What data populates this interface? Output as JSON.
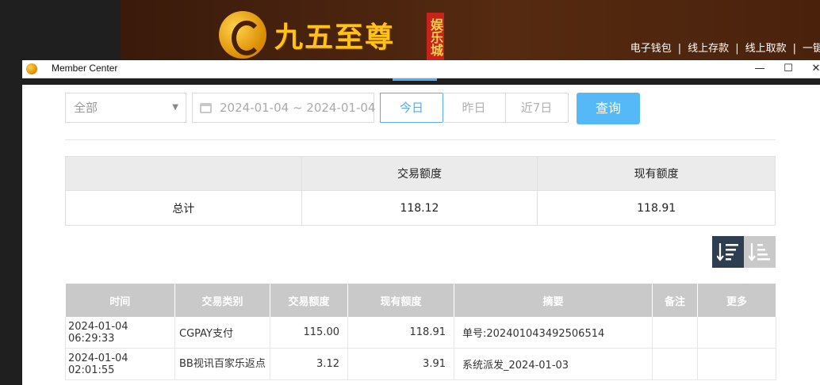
{
  "site": {
    "logo_text": "九五至尊",
    "logo_badge": "娱乐城",
    "links": [
      "电子钱包",
      "线上存款",
      "线上取款",
      "一键"
    ]
  },
  "window": {
    "title": "Member Center",
    "minimize": "—",
    "maximize": "☐",
    "close": "✕"
  },
  "filters": {
    "type_select": "全部",
    "date_range": "2024-01-04 ~ 2024-01-04",
    "quick": [
      "今日",
      "昨日",
      "近7日"
    ],
    "active_quick": "今日",
    "query_label": "查询"
  },
  "summary": {
    "headers": [
      "",
      "交易额度",
      "现有额度"
    ],
    "row": {
      "label": "总计",
      "amount": "118.12",
      "balance": "118.91"
    }
  },
  "detail": {
    "headers": [
      "时间",
      "交易类别",
      "交易额度",
      "现有额度",
      "摘要",
      "备注",
      "更多"
    ],
    "rows": [
      {
        "time": "2024-01-04 06:29:33",
        "category": "CGPAY支付",
        "amount": "115.00",
        "balance": "118.91",
        "summary": "单号:202401043492506514",
        "note": "",
        "more": ""
      },
      {
        "time": "2024-01-04 02:01:55",
        "category": "BB视讯百家乐返点",
        "amount": "3.12",
        "balance": "3.91",
        "summary": "系统派发_2024-01-03",
        "note": "",
        "more": ""
      }
    ]
  },
  "colors": {
    "accent": "#55aaf0",
    "query_button": "#55b8f7",
    "header_gray": "#c9c9c9",
    "sort_active": "#2d3e50"
  }
}
